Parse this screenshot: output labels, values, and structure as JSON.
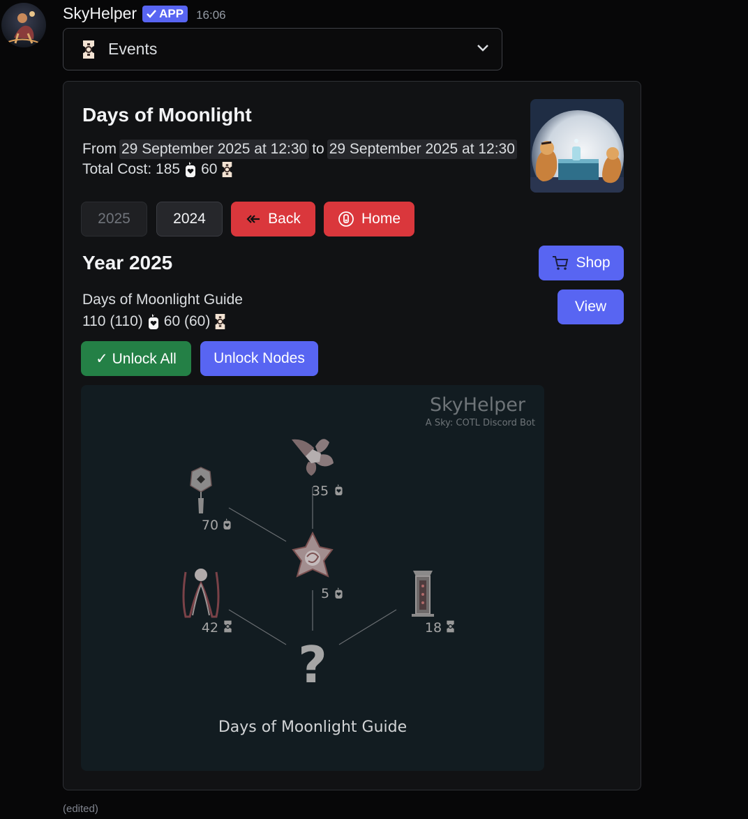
{
  "message": {
    "username": "SkyHelper",
    "app_badge": "APP",
    "timestamp": "16:06",
    "edited": "(edited)"
  },
  "select": {
    "label": "Events",
    "icon": "ticket-icon"
  },
  "card": {
    "title": "Days of Moonlight",
    "from_label": "From",
    "start": "29 September 2025 at 12:30",
    "to_label": "to",
    "end": "29 September 2025 at 12:30",
    "total_cost_label": "Total Cost: 185",
    "total_cost_tickets": "60"
  },
  "buttons": {
    "year_2025": "2025",
    "year_2024": "2024",
    "back": "Back",
    "home": "Home",
    "shop": "Shop",
    "view": "View",
    "unlock_all": "✓ Unlock All",
    "unlock_nodes": "Unlock Nodes"
  },
  "year_section": {
    "title": "Year 2025",
    "guide_name": "Days of Moonlight Guide",
    "candles_cost": "110 (110)",
    "tickets_cost": "60 (60)"
  },
  "tree": {
    "brand": "SkyHelper",
    "tagline": "A Sky: COTL Discord Bot",
    "caption": "Days of Moonlight Guide",
    "nodes": [
      {
        "item": "lantern-icon",
        "cost": "70",
        "currency": "candle-icon"
      },
      {
        "item": "flower-icon",
        "cost": "35",
        "currency": "candle-icon"
      },
      {
        "item": "emote-icon",
        "cost": "5",
        "currency": "candle-icon"
      },
      {
        "item": "cape-icon",
        "cost": "42",
        "currency": "ticket-icon"
      },
      {
        "item": "shrine-icon",
        "cost": "18",
        "currency": "ticket-icon"
      },
      {
        "item": "question-icon",
        "cost": "",
        "currency": ""
      }
    ]
  },
  "colors": {
    "background": "#070708",
    "card": "#111214",
    "blurple": "#5865f2",
    "red": "#da373c",
    "green": "#248046",
    "panel": "#121c21"
  }
}
